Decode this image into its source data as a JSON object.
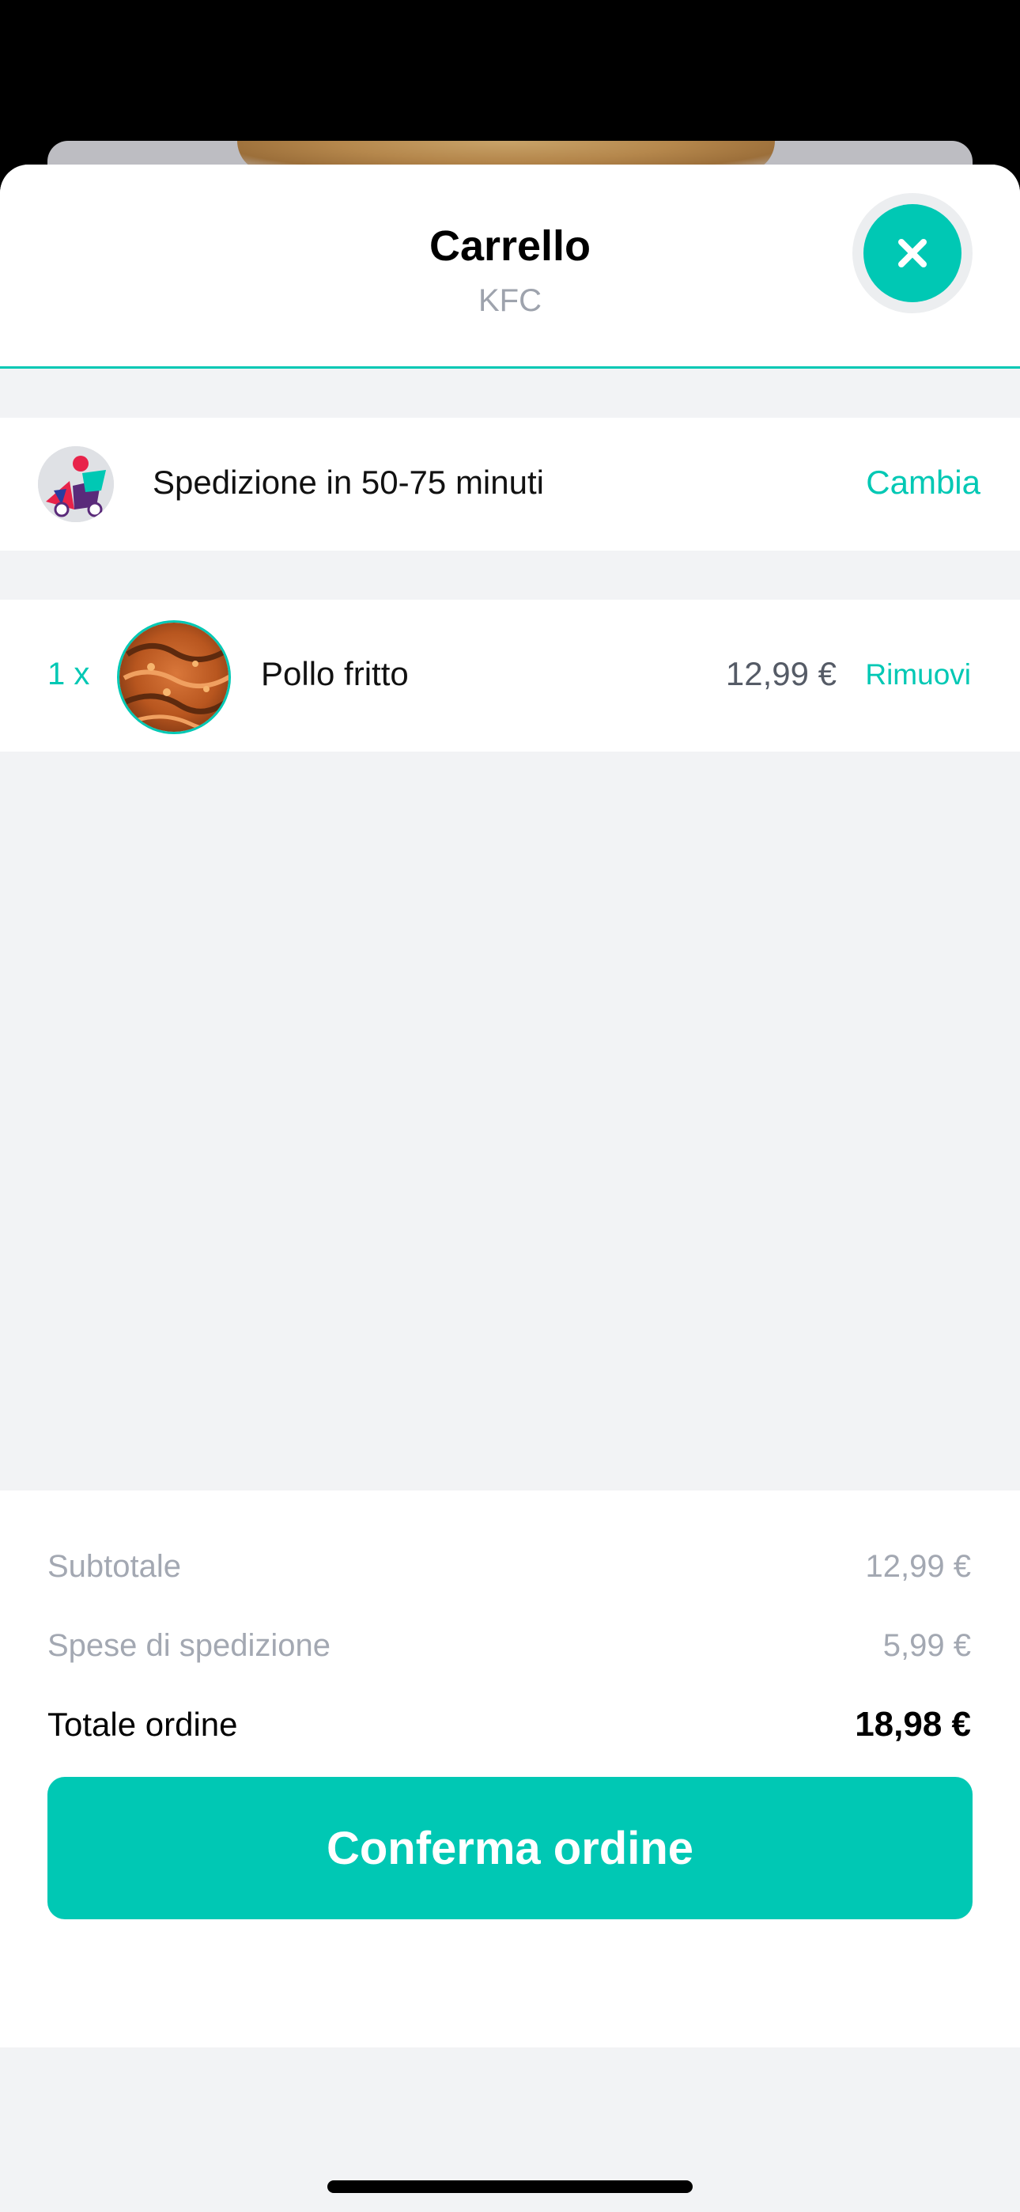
{
  "header": {
    "title": "Carrello",
    "restaurant": "KFC",
    "close_icon": "close-icon"
  },
  "delivery": {
    "icon": "delivery-rider-illustration",
    "text": "Spedizione in 50-75 minuti",
    "change_label": "Cambia"
  },
  "cart": {
    "items": [
      {
        "quantity": "1 x",
        "name": "Pollo fritto",
        "price": "12,99 €",
        "remove_label": "Rimuovi",
        "image": "fried-chicken-photo"
      }
    ]
  },
  "summary": {
    "subtotal_label": "Subtotale",
    "subtotal_value": "12,99 €",
    "shipping_label": "Spese di spedizione",
    "shipping_value": "5,99 €",
    "total_label": "Totale ordine",
    "total_value": "18,98 €"
  },
  "actions": {
    "confirm_label": "Conferma ordine"
  },
  "colors": {
    "accent": "#00c8b4",
    "background": "#f2f3f5",
    "muted_text": "#a3a8b2"
  }
}
